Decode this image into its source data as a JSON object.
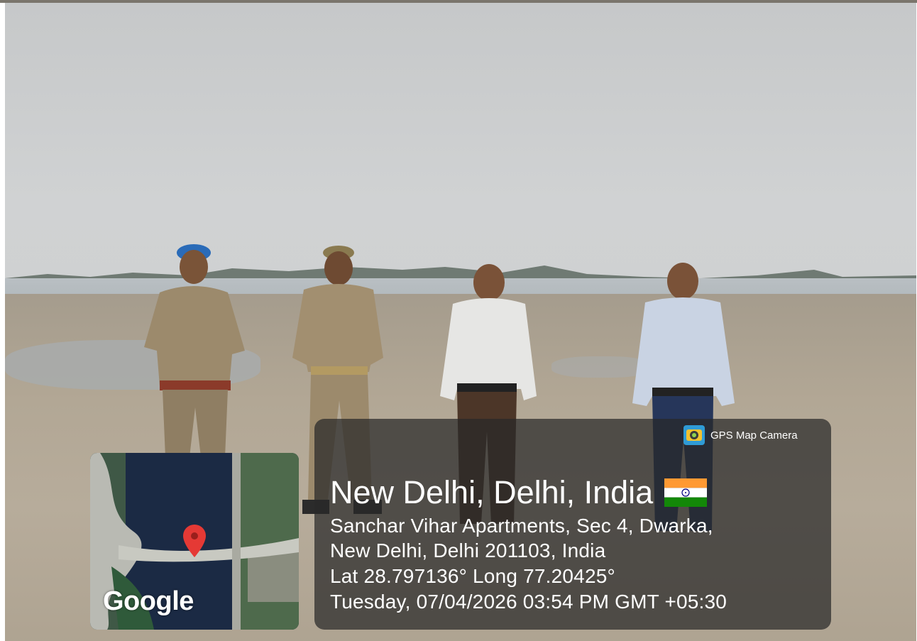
{
  "photo": {
    "description_free": true
  },
  "overlay": {
    "gps_label": "GPS Map Camera",
    "location_title": "New Delhi, Delhi, India",
    "address_line1": "Sanchar Vihar Apartments, Sec 4, Dwarka,",
    "address_line2": "New Delhi, Delhi 201103, India",
    "coordinates": "Lat 28.797136° Long 77.20425°",
    "datetime": "Tuesday, 07/04/2026 03:54 PM GMT +05:30",
    "map_brand": "Google",
    "flag_icon": "india-flag-icon",
    "pin_icon": "map-pin-icon",
    "camera_icon": "gps-map-camera-icon"
  },
  "colors": {
    "overlay_bg": "#282828",
    "pin": "#e53935",
    "uniform": "#9c8a6c"
  }
}
